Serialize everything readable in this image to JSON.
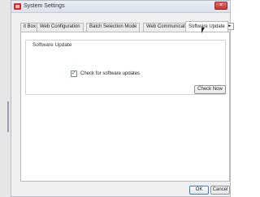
{
  "window": {
    "title": "System Settings",
    "close_glyph": "×"
  },
  "tabs": [
    {
      "label": "it Box"
    },
    {
      "label": "Web Configuration"
    },
    {
      "label": "Batch Selection Mode"
    },
    {
      "label": "Web Communication"
    },
    {
      "label": "Software Update",
      "active": true
    }
  ],
  "tab_scroll": {
    "glyph": "◂▸"
  },
  "software_update": {
    "group_title": "Software Update",
    "check_label": "Check for software updates",
    "checked": true,
    "check_glyph": "✓",
    "check_now_label": "Check Now"
  },
  "footer": {
    "ok_label": "OK",
    "cancel_label": "Cancel"
  }
}
